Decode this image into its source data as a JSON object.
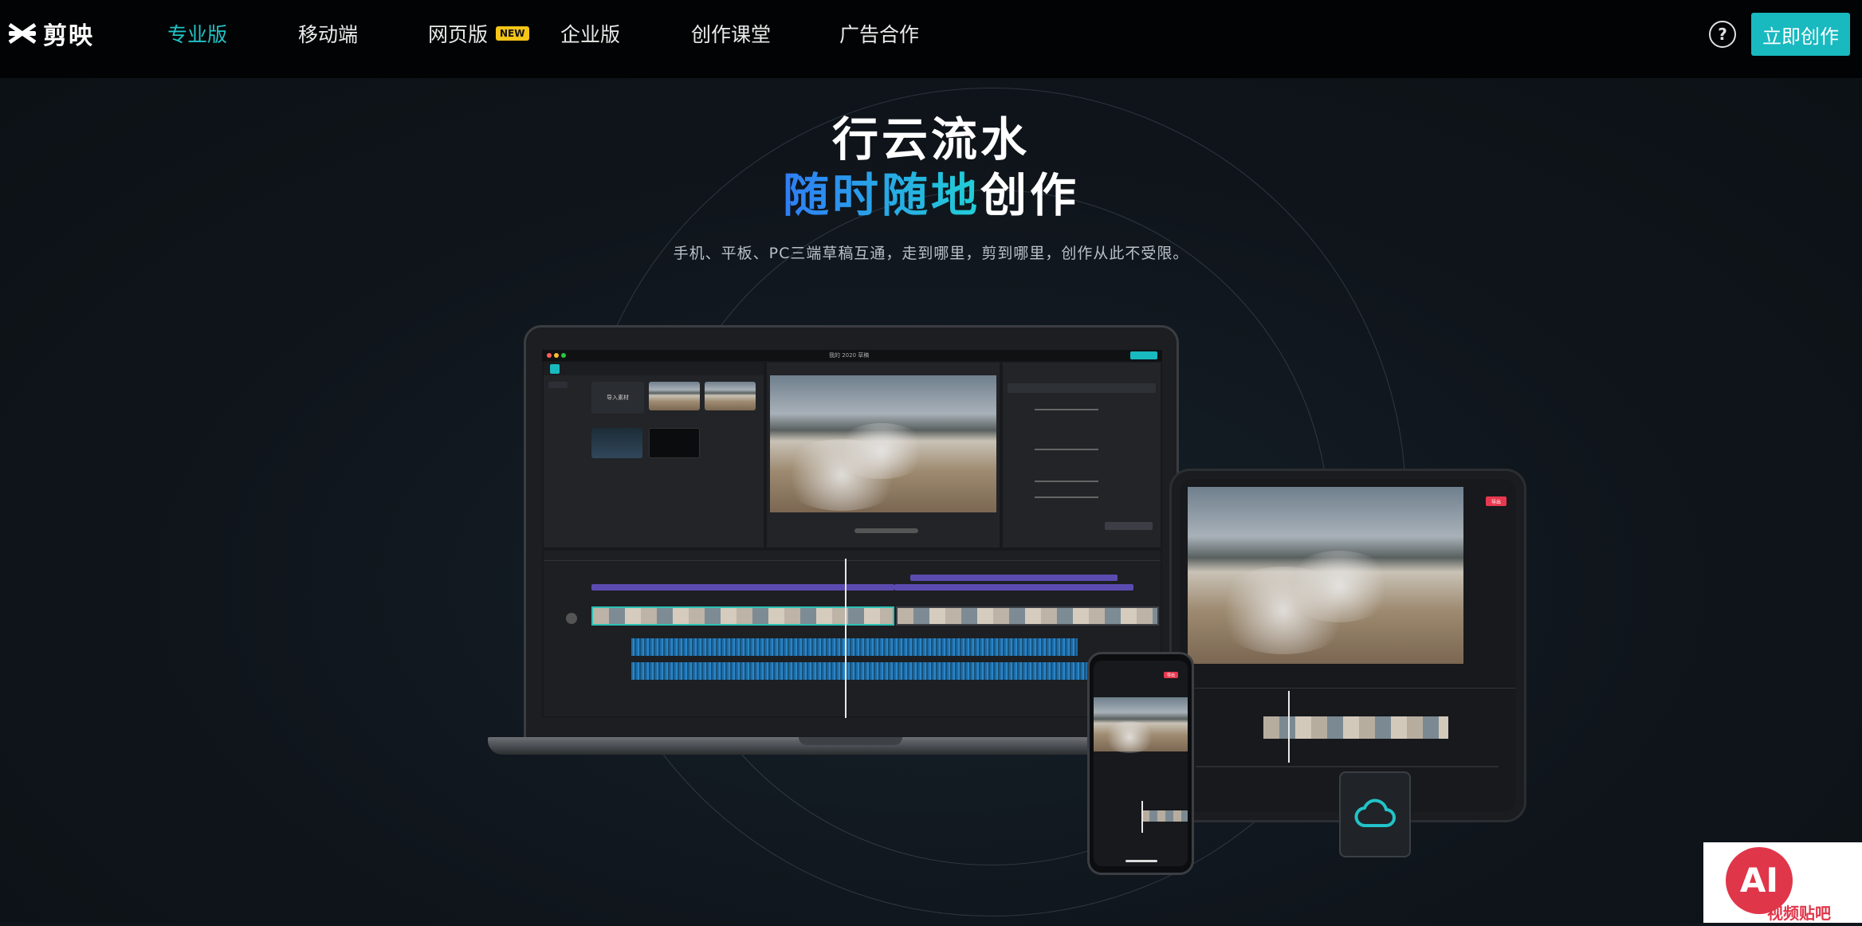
{
  "brand": {
    "name": "剪映"
  },
  "nav": {
    "items": [
      {
        "label": "专业版",
        "active": true
      },
      {
        "label": "移动端",
        "active": false
      },
      {
        "label": "网页版",
        "active": false,
        "badge": "NEW"
      },
      {
        "label": "企业版",
        "active": false
      },
      {
        "label": "创作课堂",
        "active": false
      },
      {
        "label": "广告合作",
        "active": false
      }
    ],
    "help_icon": "question-circle-icon",
    "cta_label": "立即创作"
  },
  "hero": {
    "headline_line1": "行云流水",
    "headline_line2_highlight": "随时随地",
    "headline_line2_rest": "创作",
    "subtitle": "手机、平板、PC三端草稿互通，走到哪里，剪到哪里，创作从此不受限。"
  },
  "colors": {
    "accent": "#19b9c0",
    "nav_active": "#22c3c8",
    "badge": "#f5c518",
    "gradient_start": "#2f7cf6",
    "gradient_end": "#21d0d6",
    "export_red": "#e8384f"
  },
  "devices": {
    "laptop_title": "我的 2020 草稿",
    "laptop_import_label": "导入素材",
    "tablet_export_label": "导出",
    "phone_export_label": "导出"
  },
  "watermark": {
    "logo": "AI",
    "text": "视频贴吧"
  }
}
